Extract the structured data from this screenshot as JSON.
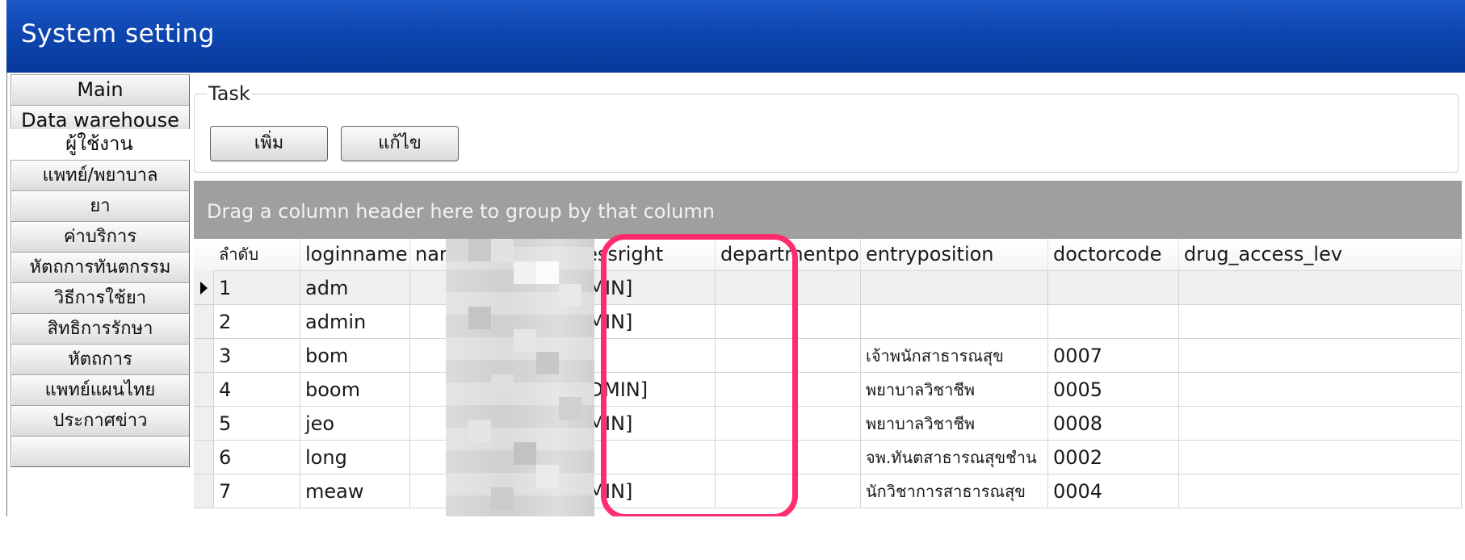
{
  "window": {
    "title": "System setting"
  },
  "sidebar": {
    "items": [
      {
        "label": "Main",
        "selected": false
      },
      {
        "label": "Data warehouse",
        "selected": false
      },
      {
        "label": "ผู้ใช้งาน",
        "selected": true
      },
      {
        "label": "แพทย์/พยาบาล",
        "selected": false
      },
      {
        "label": "ยา",
        "selected": false
      },
      {
        "label": "ค่าบริการ",
        "selected": false
      },
      {
        "label": "หัตถการทันตกรรม",
        "selected": false
      },
      {
        "label": "วิธีการใช้ยา",
        "selected": false
      },
      {
        "label": "สิทธิการรักษา",
        "selected": false
      },
      {
        "label": "หัตถการ",
        "selected": false
      },
      {
        "label": "แพทย์แผนไทย",
        "selected": false
      },
      {
        "label": "ประกาศข่าว",
        "selected": false
      }
    ]
  },
  "task": {
    "legend": "Task",
    "add_label": "เพิ่ม",
    "edit_label": "แก้ไข"
  },
  "grid": {
    "group_hint": "Drag a column header here to group by that column",
    "columns": [
      "ลำดับ",
      "loginname",
      "name",
      "accessright",
      "departmentpositi",
      "entryposition",
      "doctorcode",
      "drug_access_lev"
    ],
    "rows": [
      {
        "no": "1",
        "loginname": "adm",
        "name": "",
        "accessright": "[ADMIN]",
        "departmentposition": "",
        "entryposition": "",
        "doctorcode": "",
        "drug_access_level": "",
        "current": true
      },
      {
        "no": "2",
        "loginname": "admin",
        "name": "",
        "accessright": "[ADMIN]",
        "departmentposition": "",
        "entryposition": "",
        "doctorcode": "",
        "drug_access_level": "",
        "current": false
      },
      {
        "no": "3",
        "loginname": "bom",
        "name": "",
        "accessright": "",
        "departmentposition": "",
        "entryposition": "เจ้าพนักสาธารณสุข",
        "doctorcode": "0007",
        "drug_access_level": "",
        "current": false
      },
      {
        "no": "4",
        "loginname": "boom",
        "name": "",
        "accessright": "[][ADMIN]",
        "departmentposition": "",
        "entryposition": "พยาบาลวิชาชีพ",
        "doctorcode": "0005",
        "drug_access_level": "",
        "current": false
      },
      {
        "no": "5",
        "loginname": "jeo",
        "name": "",
        "accessright": "[ADMIN]",
        "departmentposition": "",
        "entryposition": "พยาบาลวิชาชีพ",
        "doctorcode": "0008",
        "drug_access_level": "",
        "current": false
      },
      {
        "no": "6",
        "loginname": "long",
        "name": "",
        "accessright": "",
        "departmentposition": "",
        "entryposition": "จพ.ทันตสาธารณสุขชำน",
        "doctorcode": "0002",
        "drug_access_level": "",
        "current": false
      },
      {
        "no": "7",
        "loginname": "meaw",
        "name": "",
        "accessright": "[ADMIN]",
        "departmentposition": "",
        "entryposition": "นักวิชาการสาธารณสุข",
        "doctorcode": "0004",
        "drug_access_level": "",
        "current": false
      }
    ]
  },
  "colors": {
    "titlebar": "#0e46b0",
    "group_panel": "#9f9f9f",
    "highlight": "#ff2d6e"
  }
}
